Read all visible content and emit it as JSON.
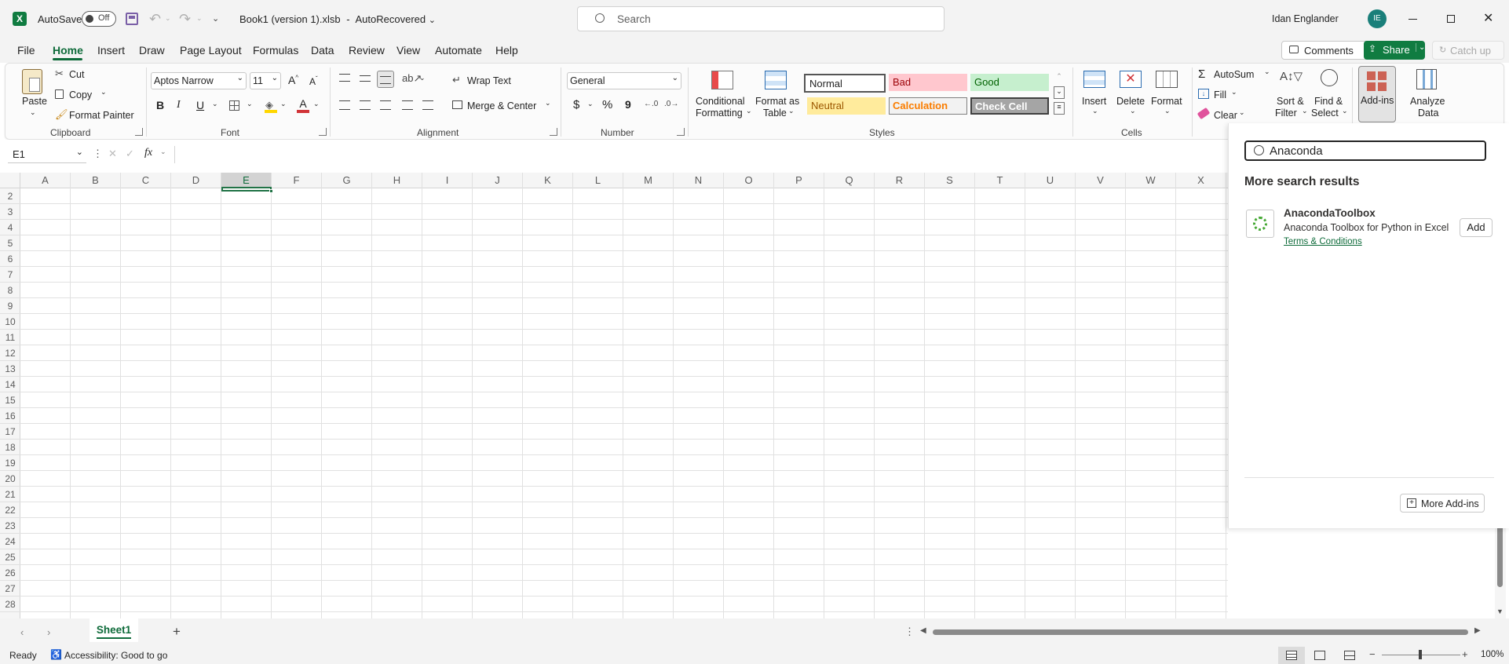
{
  "titlebar": {
    "autosave_label": "AutoSave",
    "autosave_state": "Off",
    "doc_title": "Book1 (version 1).xlsb",
    "doc_sep": "-",
    "doc_status": "AutoRecovered",
    "search_placeholder": "Search",
    "user_name": "Idan Englander",
    "user_initials": "IE"
  },
  "menu": {
    "items": [
      "File",
      "Home",
      "Insert",
      "Draw",
      "Page Layout",
      "Formulas",
      "Data",
      "Review",
      "View",
      "Automate",
      "Help"
    ],
    "active": "Home",
    "comments": "Comments",
    "share": "Share",
    "catch_up": "Catch up"
  },
  "ribbon": {
    "clipboard": {
      "paste": "Paste",
      "cut": "Cut",
      "copy": "Copy",
      "format_painter": "Format Painter",
      "group": "Clipboard"
    },
    "font": {
      "name": "Aptos Narrow",
      "size": "11",
      "bold": "B",
      "italic": "I",
      "underline": "U",
      "grow": "A",
      "shrink": "A",
      "color": "A",
      "group": "Font"
    },
    "alignment": {
      "wrap": "Wrap Text",
      "merge": "Merge & Center",
      "group": "Alignment"
    },
    "number": {
      "format": "General",
      "currency": "$",
      "percent": "%",
      "comma": "9",
      "group": "Number"
    },
    "styles": {
      "conditional_1": "Conditional",
      "conditional_2": "Formatting",
      "table_1": "Format as",
      "table_2": "Table",
      "normal": "Normal",
      "bad": "Bad",
      "good": "Good",
      "neutral": "Neutral",
      "calculation": "Calculation",
      "check": "Check Cell",
      "group": "Styles"
    },
    "cells": {
      "insert": "Insert",
      "delete": "Delete",
      "format": "Format",
      "group": "Cells"
    },
    "editing": {
      "autosum": "AutoSum",
      "fill": "Fill",
      "clear": "Clear",
      "sort_1": "Sort &",
      "sort_2": "Filter",
      "find_1": "Find &",
      "find_2": "Select"
    },
    "addins": "Add-ins",
    "analyze_1": "Analyze",
    "analyze_2": "Data"
  },
  "formula_bar": {
    "name_box": "E1",
    "fx": "fx",
    "value": ""
  },
  "grid": {
    "columns": [
      "A",
      "B",
      "C",
      "D",
      "E",
      "F",
      "G",
      "H",
      "I",
      "J",
      "K",
      "L",
      "M",
      "N",
      "O",
      "P",
      "Q",
      "R",
      "S",
      "T",
      "U",
      "V",
      "W",
      "X"
    ],
    "rows": [
      "2",
      "3",
      "4",
      "5",
      "6",
      "7",
      "8",
      "9",
      "10",
      "11",
      "12",
      "13",
      "14",
      "15",
      "16",
      "17",
      "18",
      "19",
      "20",
      "21",
      "22",
      "23",
      "24",
      "25",
      "26",
      "27",
      "28"
    ],
    "selected_cell": "E1"
  },
  "addins_panel": {
    "search_value": "Anaconda",
    "heading": "More search results",
    "result_name": "AnacondaToolbox",
    "result_desc": "Anaconda Toolbox for Python in Excel",
    "result_terms": "Terms & Conditions",
    "add_button": "Add",
    "more_addins": "More Add-ins"
  },
  "sheets": {
    "tabs": [
      "Sheet1"
    ],
    "active": "Sheet1"
  },
  "status": {
    "ready": "Ready",
    "accessibility": "Accessibility: Good to go",
    "zoom": "100%"
  },
  "colors": {
    "excel_green": "#107c41",
    "accent_text": "#0e6b3a",
    "selection": "#217346"
  }
}
